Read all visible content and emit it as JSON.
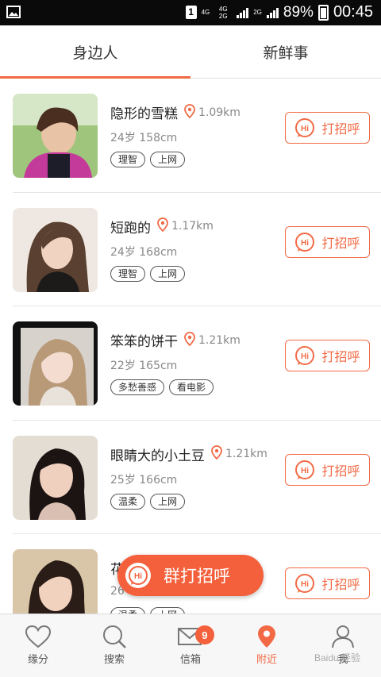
{
  "status_bar": {
    "sim": "1",
    "net1": "4G",
    "net2": "4G 2G",
    "net3": "2G",
    "battery": "89%",
    "time": "00:45"
  },
  "tabs": [
    {
      "label": "身边人",
      "active": true
    },
    {
      "label": "新鲜事",
      "active": false
    }
  ],
  "users": [
    {
      "name": "隐形的雪糕",
      "distance": "1.09km",
      "meta": "24岁 158cm",
      "tags": [
        "理智",
        "上网"
      ],
      "greet": "打招呼"
    },
    {
      "name": "短跑的",
      "distance": "1.17km",
      "meta": "24岁 168cm",
      "tags": [
        "理智",
        "上网"
      ],
      "greet": "打招呼"
    },
    {
      "name": "笨笨的饼干",
      "distance": "1.21km",
      "meta": "22岁 165cm",
      "tags": [
        "多愁善感",
        "看电影"
      ],
      "greet": "打招呼"
    },
    {
      "name": "眼睛大的小土豆",
      "distance": "1.21km",
      "meta": "25岁 166cm",
      "tags": [
        "温柔",
        "上网"
      ],
      "greet": "打招呼"
    },
    {
      "name": "花",
      "distance": "",
      "meta": "26",
      "tags": [
        "温柔",
        "上网"
      ],
      "greet": "打招呼"
    }
  ],
  "mass_greet": {
    "label": "群打招呼",
    "hi": "Hi"
  },
  "greet_hi": "Hi",
  "nav": [
    {
      "label": "缘分",
      "icon": "heart-icon"
    },
    {
      "label": "搜索",
      "icon": "search-icon"
    },
    {
      "label": "信箱",
      "icon": "mail-icon",
      "badge": "9"
    },
    {
      "label": "附近",
      "icon": "location-pin-icon",
      "active": true
    },
    {
      "label": "我",
      "icon": "profile-icon"
    }
  ],
  "watermark": "Baidu 经验",
  "accent_color": "#f26a45"
}
